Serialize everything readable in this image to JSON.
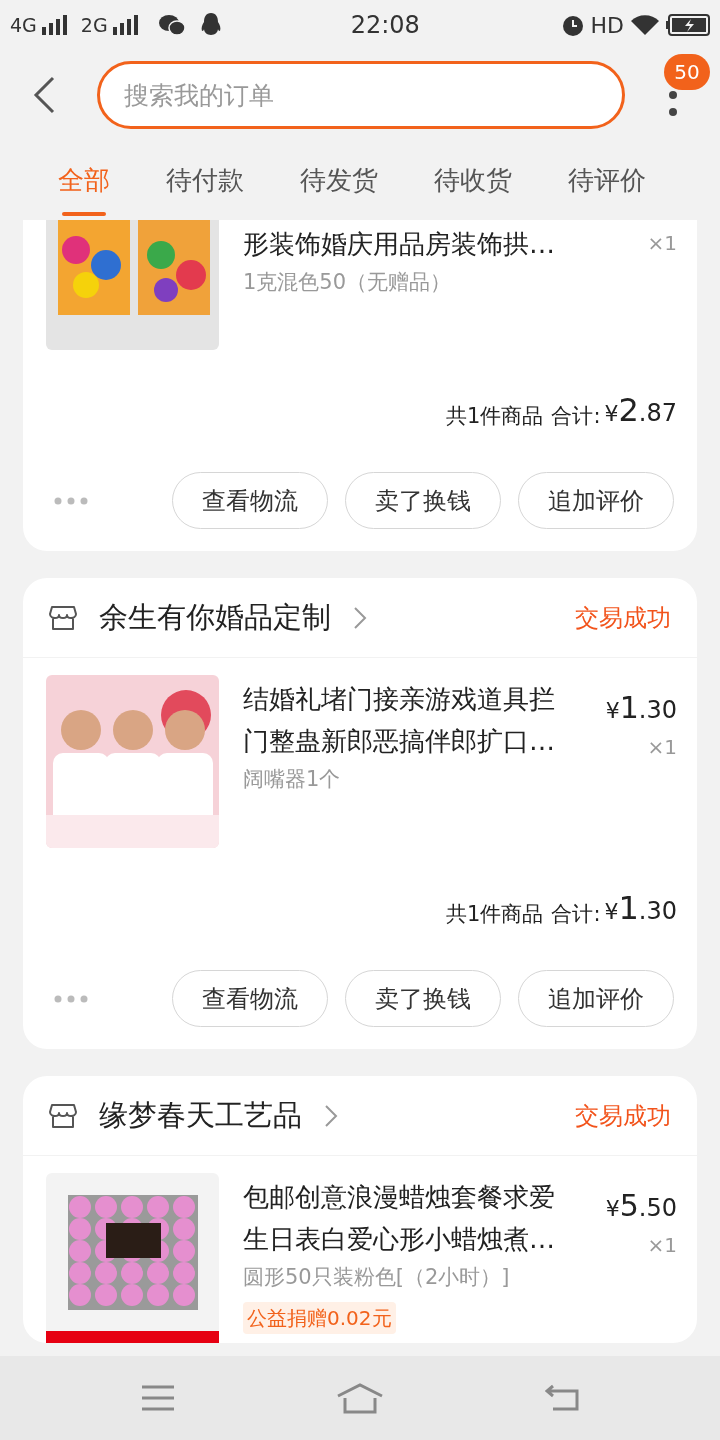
{
  "status_bar": {
    "network_1": "4G",
    "network_2": "2G",
    "time": "22:08",
    "hd": "HD"
  },
  "header": {
    "search": {
      "placeholder": "搜索我的订单"
    },
    "badge": "50"
  },
  "tabs": [
    {
      "label": "全部",
      "selected": true
    },
    {
      "label": "待付款",
      "selected": false
    },
    {
      "label": "待发货",
      "selected": false
    },
    {
      "label": "待收货",
      "selected": false
    },
    {
      "label": "待评价",
      "selected": false
    }
  ],
  "orders": [
    {
      "item": {
        "title": "形装饰婚庆用品房装饰拱…",
        "spec": "1克混色50（无赠品）",
        "qty": "×1"
      },
      "summary": {
        "count": "共1件商品",
        "total_label": "合计:",
        "currency": "¥",
        "integer": "2",
        "decimal": ".87"
      },
      "actions": [
        "查看物流",
        "卖了换钱",
        "追加评价"
      ]
    },
    {
      "store": "余生有你婚品定制",
      "status": "交易成功",
      "item": {
        "title": "结婚礼堵门接亲游戏道具拦门整蛊新郎恶搞伴郎扩口…",
        "spec": "阔嘴器1个",
        "currency": "¥",
        "integer": "1",
        "decimal": ".30",
        "qty": "×1"
      },
      "summary": {
        "count": "共1件商品",
        "total_label": "合计:",
        "currency": "¥",
        "integer": "1",
        "decimal": ".30"
      },
      "actions": [
        "查看物流",
        "卖了换钱",
        "追加评价"
      ]
    },
    {
      "store": "缘梦春天工艺品",
      "status": "交易成功",
      "item": {
        "title": "包邮创意浪漫蜡烛套餐求爱生日表白爱心形小蜡烛煮…",
        "spec": "圆形50只装粉色[（2小时）]",
        "tag": "公益捐赠0.02元",
        "currency": "¥",
        "integer": "5",
        "decimal": ".50",
        "qty": "×1"
      }
    }
  ]
}
